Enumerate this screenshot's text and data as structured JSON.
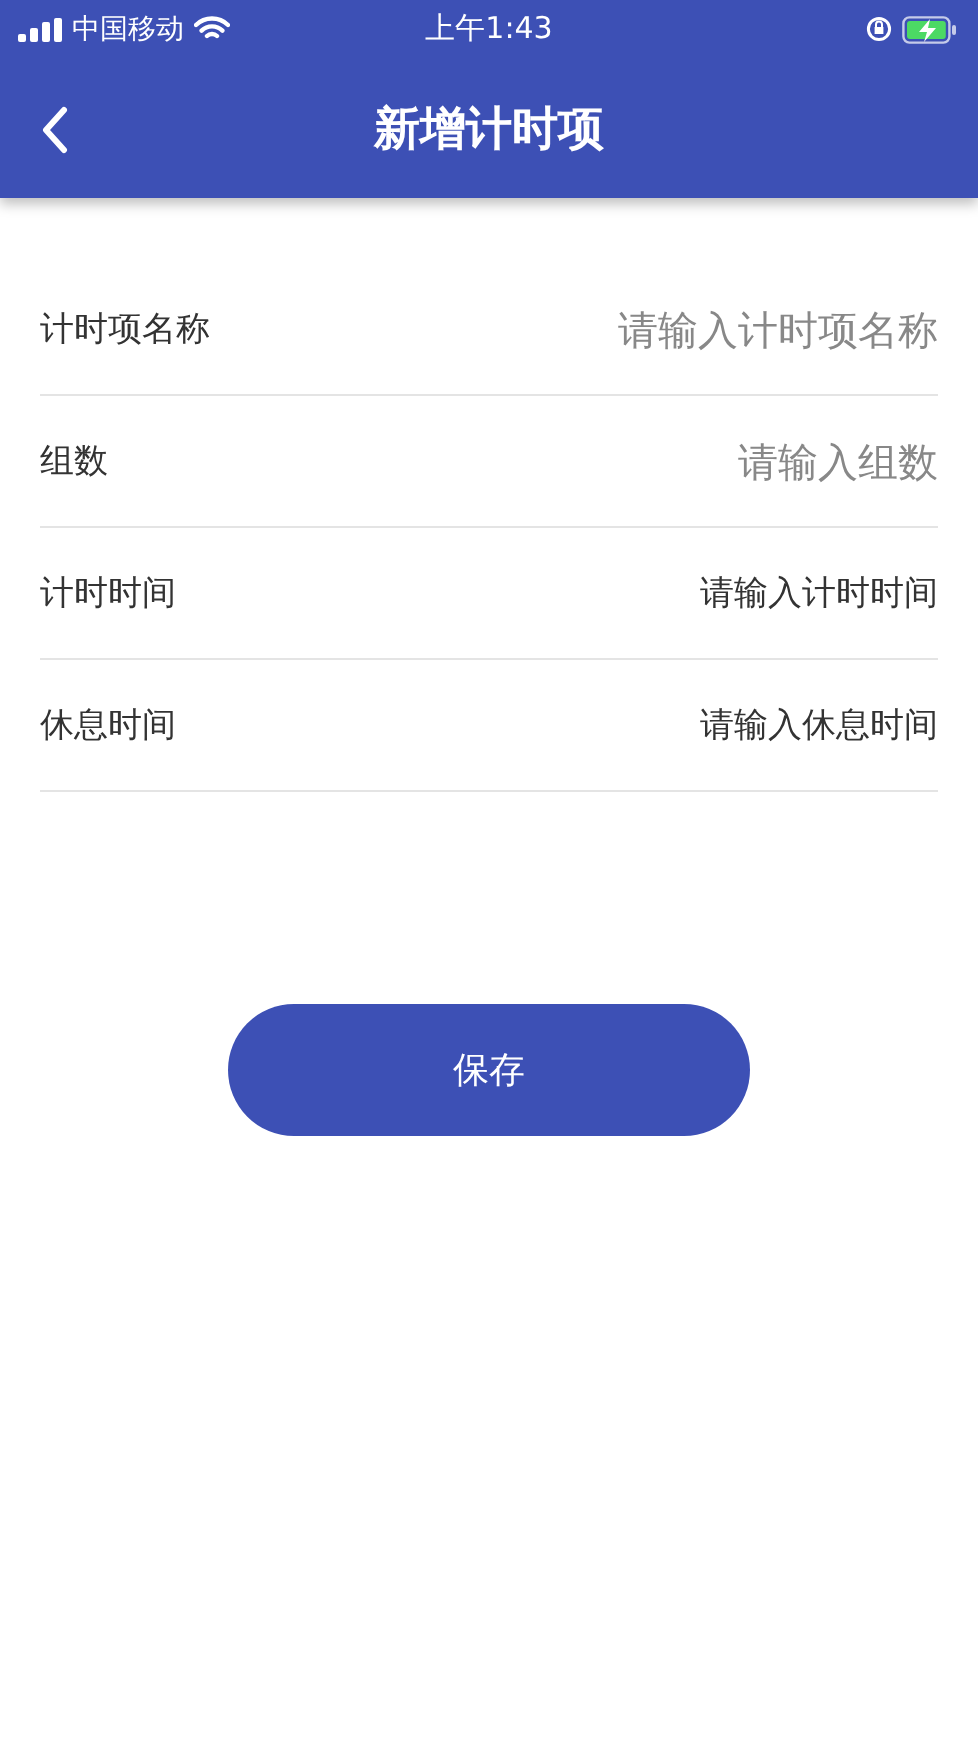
{
  "status_bar": {
    "carrier": "中国移动",
    "time": "上午1:43"
  },
  "nav": {
    "title": "新增计时项"
  },
  "fields": [
    {
      "label": "计时项名称",
      "kind": "input",
      "placeholder": "请输入计时项名称"
    },
    {
      "label": "组数",
      "kind": "input",
      "placeholder": "请输入组数"
    },
    {
      "label": "计时时间",
      "kind": "picker",
      "value": "请输入计时时间"
    },
    {
      "label": "休息时间",
      "kind": "picker",
      "value": "请输入休息时间"
    }
  ],
  "save_button": {
    "label": "保存"
  }
}
